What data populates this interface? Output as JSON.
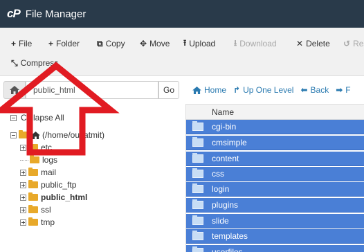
{
  "app": {
    "logo": "cP",
    "title": "File Manager"
  },
  "toolbar": {
    "file": "File",
    "folder": "Folder",
    "copy": "Copy",
    "move": "Move",
    "upload": "Upload",
    "download": "Download",
    "delete": "Delete",
    "restore": "Res",
    "compress": "Compress"
  },
  "path": {
    "value": "public_html",
    "go": "Go"
  },
  "nav": {
    "home": "Home",
    "up": "Up One Level",
    "back": "Back",
    "forward": "F"
  },
  "tree": {
    "collapse_all": "Collapse All",
    "root": "(/home/ousatmit)",
    "items": [
      "etc",
      "logs",
      "mail",
      "public_ftp",
      "public_html",
      "ssl",
      "tmp"
    ]
  },
  "files": {
    "header_name": "Name",
    "rows": [
      "cgi-bin",
      "cmsimple",
      "content",
      "css",
      "login",
      "plugins",
      "slide",
      "templates",
      "userfiles"
    ]
  },
  "colors": {
    "titlebar": "#293a4a",
    "selection": "#4a7fd6",
    "folder": "#e8a92a",
    "arrow": "#e11b22",
    "link": "#2a7ab0"
  }
}
